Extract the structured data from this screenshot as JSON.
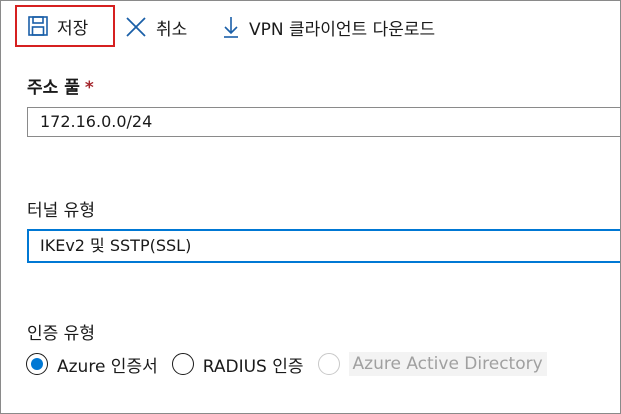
{
  "toolbar": {
    "save_label": "저장",
    "cancel_label": "취소",
    "download_label": "VPN 클라이언트 다운로드"
  },
  "address_pool": {
    "label": "주소 풀",
    "required_marker": "*",
    "value": "172.16.0.0/24"
  },
  "tunnel_type": {
    "label": "터널 유형",
    "selected": "IKEv2 및 SSTP(SSL)"
  },
  "auth_type": {
    "label": "인증 유형",
    "options": [
      {
        "label": "Azure 인증서",
        "selected": true,
        "disabled": false
      },
      {
        "label": "RADIUS 인증",
        "selected": false,
        "disabled": false
      },
      {
        "label": "Azure Active Directory",
        "selected": false,
        "disabled": true
      }
    ]
  },
  "colors": {
    "accent": "#0078d4",
    "highlight_border": "#d62020",
    "required": "#a4262c"
  }
}
